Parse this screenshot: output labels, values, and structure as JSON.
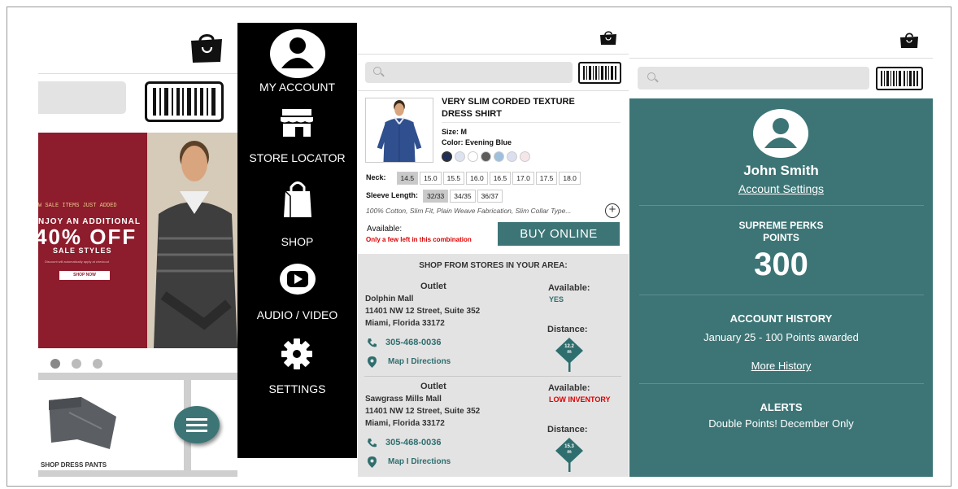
{
  "panel_home": {
    "hero": {
      "line1": "W SALE ITEMS JUST ADDED",
      "line2": "NJOY AN ADDITIONAL",
      "line3": "40% OFF",
      "line4": "SALE STYLES",
      "fine_print": "Discount will automatically apply at checkout",
      "cta": "SHOP NOW"
    },
    "tile_label": "SHOP DRESS PANTS"
  },
  "menu": {
    "items": [
      {
        "label": "MY ACCOUNT",
        "icon": "user-circle-icon"
      },
      {
        "label": "STORE LOCATOR",
        "icon": "storefront-icon"
      },
      {
        "label": "SHOP",
        "icon": "shopping-bag-icon"
      },
      {
        "label": "AUDIO / VIDEO",
        "icon": "play-icon"
      },
      {
        "label": "SETTINGS",
        "icon": "gear-icon"
      }
    ]
  },
  "product": {
    "title": "VERY SLIM CORDED TEXTURE DRESS SHIRT",
    "size": "Size: M",
    "color": "Color: Evening Blue",
    "swatches": [
      "#1f2f5c",
      "#dde4f0",
      "#ffffff",
      "#5c5c5c",
      "#9fc0dd",
      "#dcdff0",
      "#f5e6ea"
    ],
    "neck_label": "Neck:",
    "neck_options": [
      "14.5",
      "15.0",
      "15.5",
      "16.0",
      "16.5",
      "17.0",
      "17.5",
      "18.0"
    ],
    "neck_selected": "14.5",
    "sleeve_label": "Sleeve Length:",
    "sleeve_options": [
      "32/33",
      "34/35",
      "36/37"
    ],
    "sleeve_selected": "32/33",
    "description": "100% Cotton, Slim Fit, Plain Weave Fabrication, Slim Collar Type...",
    "available_label": "Available:",
    "availability_note": "Only a few left in this combination",
    "buy_label": "BUY ONLINE"
  },
  "stores": {
    "title": "SHOP FROM STORES IN YOUR AREA:",
    "list": [
      {
        "type": "Outlet",
        "name": "Dolphin Mall",
        "address1": "11401 NW 12 Street, Suite 352",
        "address2": "Miami, Florida 33172",
        "phone": "305-468-0036",
        "map": "Map I Directions",
        "available_label": "Available:",
        "available": "YES",
        "distance_label": "Distance:",
        "distance": "12.2",
        "distance_unit": "m"
      },
      {
        "type": "Outlet",
        "name": "Sawgrass Mills Mall",
        "address1": "11401 NW 12 Street, Suite 352",
        "address2": "Miami, Florida 33172",
        "phone": "305-468-0036",
        "map": "Map I Directions",
        "available_label": "Available:",
        "available": "LOW INVENTORY",
        "distance_label": "Distance:",
        "distance": "15.3",
        "distance_unit": "m"
      }
    ]
  },
  "account": {
    "name": "John Smith",
    "settings_link": "Account Settings",
    "perks_title_1": "SUPREME PERKS",
    "perks_title_2": "POINTS",
    "points": "300",
    "history_title": "ACCOUNT HISTORY",
    "history_item": "January 25 - 100 Points awarded",
    "more_history": "More History",
    "alerts_title": "ALERTS",
    "alert_item": "Double Points! December Only"
  },
  "colors": {
    "teal": "#3d7576",
    "sale_red": "#8d1c2c",
    "alert_red": "#dd0000"
  }
}
